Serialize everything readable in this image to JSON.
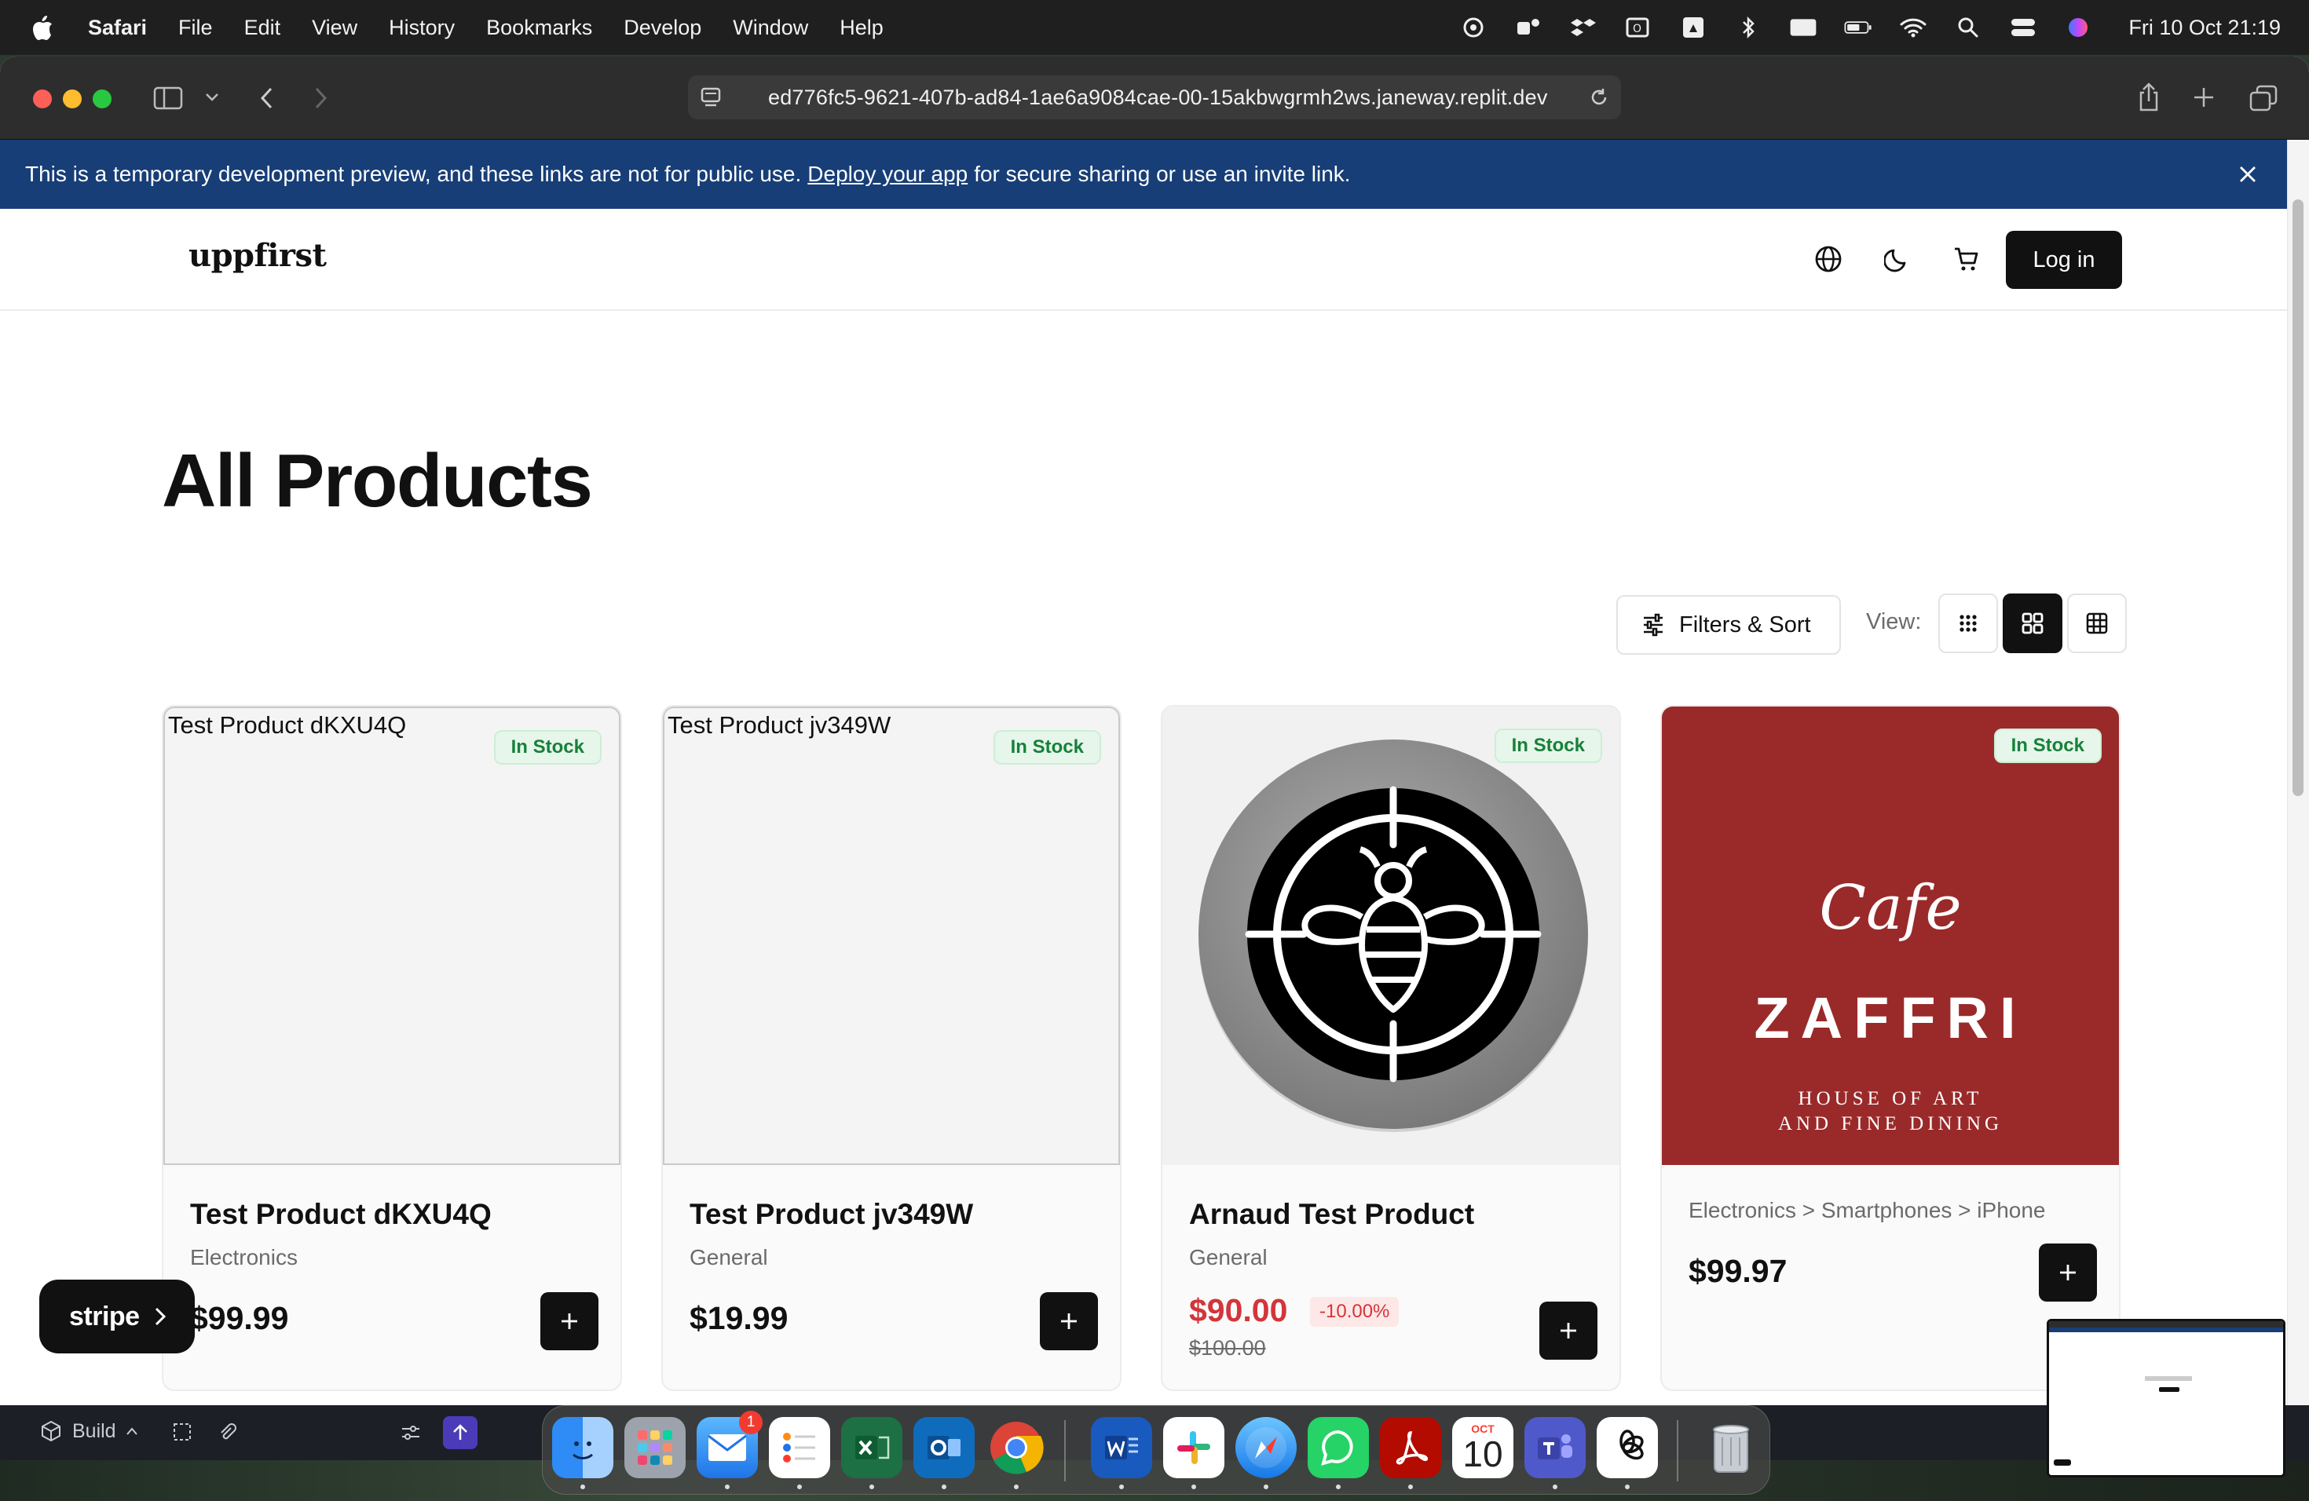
{
  "menubar": {
    "app_name": "Safari",
    "items": [
      "File",
      "Edit",
      "View",
      "History",
      "Bookmarks",
      "Develop",
      "Window",
      "Help"
    ],
    "input_indicator": "A",
    "clock": "Fri 10 Oct  21:19"
  },
  "browser": {
    "url": "ed776fc5-9621-407b-ad84-1ae6a9084cae-00-15akbwgrmh2ws.janeway.replit.dev"
  },
  "dev_banner": {
    "text_before": "This is a temporary development preview, and these links are not for public use.",
    "link": "Deploy your app",
    "text_after": "for secure sharing or use an invite link."
  },
  "header": {
    "logo": "uppfirst",
    "login_label": "Log in"
  },
  "page": {
    "title": "All Products",
    "filters_label": "Filters & Sort",
    "view_label": "View:"
  },
  "products": [
    {
      "alt": "Test Product dKXU4Q",
      "stock": "In Stock",
      "name": "Test Product dKXU4Q",
      "category": "Electronics",
      "price": "$99.99"
    },
    {
      "alt": "Test Product jv349W",
      "stock": "In Stock",
      "name": "Test Product jv349W",
      "category": "General",
      "price": "$19.99"
    },
    {
      "stock": "In Stock",
      "name": "Arnaud Test Product",
      "category": "General",
      "price": "$90.00",
      "discount": "-10.00%",
      "original_price": "$100.00"
    },
    {
      "stock": "In Stock",
      "category": "Electronics > Smartphones > iPhone",
      "price": "$99.97",
      "logo_script": "Cafe",
      "logo_name": "ZAFFRI",
      "logo_line1": "HOUSE OF ART",
      "logo_line2": "AND FINE DINING"
    }
  ],
  "stripe_badge": {
    "label": "stripe"
  },
  "replit": {
    "build_label": "Build"
  },
  "dock": {
    "mail_badge": "1",
    "calendar_month": "OCT",
    "calendar_day": "10"
  },
  "colors": {
    "banner": "#173e77",
    "in_stock_text": "#17803a",
    "sale_price": "#d3353a",
    "cafe_red": "#9a2a2a"
  }
}
